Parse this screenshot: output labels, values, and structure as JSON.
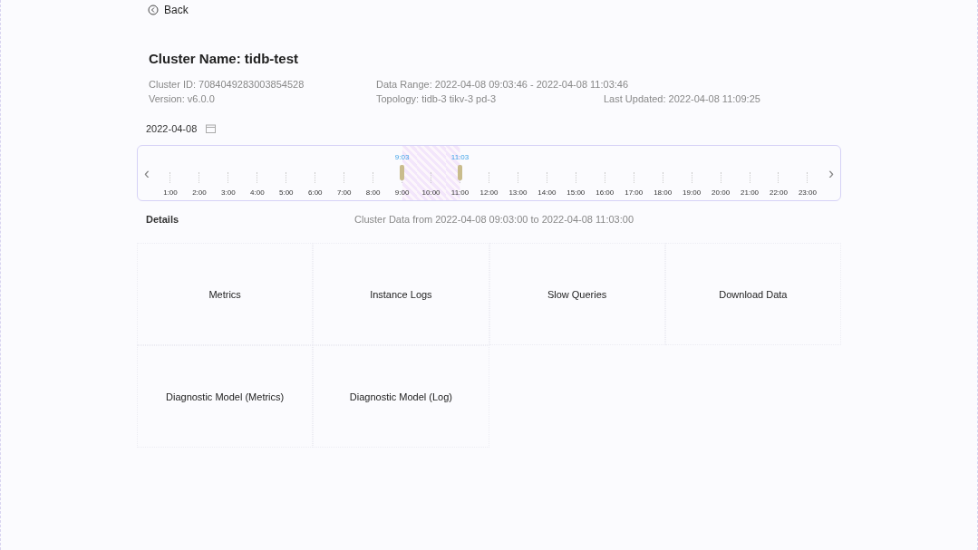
{
  "back": {
    "label": "Back"
  },
  "title": "Cluster Name: tidb-test",
  "info": [
    [
      "Cluster ID: 7084049283003854528",
      "Data Range: 2022-04-08 09:03:46 - 2022-04-08 11:03:46"
    ],
    [
      "Version: v6.0.0",
      "Topology: tidb-3 tikv-3 pd-3",
      "Last Updated: 2022-04-08 11:09:25"
    ]
  ],
  "date": "2022-04-08",
  "timeline": {
    "prev": "‹",
    "next": "›",
    "start_label": "9:03",
    "end_label": "11:03",
    "hours": [
      {
        "label": "1:00",
        "in_range": false
      },
      {
        "label": "2:00",
        "in_range": false
      },
      {
        "label": "3:00",
        "in_range": false
      },
      {
        "label": "4:00",
        "in_range": false
      },
      {
        "label": "5:00",
        "in_range": false
      },
      {
        "label": "6:00",
        "in_range": false
      },
      {
        "label": "7:00",
        "in_range": false
      },
      {
        "label": "8:00",
        "in_range": false
      },
      {
        "label": "9:00",
        "in_range": true
      },
      {
        "label": "10:00",
        "in_range": true
      },
      {
        "label": "11:00",
        "in_range": true
      },
      {
        "label": "12:00",
        "in_range": false
      },
      {
        "label": "13:00",
        "in_range": false
      },
      {
        "label": "14:00",
        "in_range": false
      },
      {
        "label": "15:00",
        "in_range": false
      },
      {
        "label": "16:00",
        "in_range": false
      },
      {
        "label": "17:00",
        "in_range": false
      },
      {
        "label": "18:00",
        "in_range": false
      },
      {
        "label": "19:00",
        "in_range": false
      },
      {
        "label": "20:00",
        "in_range": false
      },
      {
        "label": "21:00",
        "in_range": false
      },
      {
        "label": "22:00",
        "in_range": false
      },
      {
        "label": "23:00",
        "in_range": false
      }
    ]
  },
  "details": {
    "label": "Details",
    "summary": "Cluster Data from 2022-04-08 09:03:00 to 2022-04-08 11:03:00"
  },
  "cards": [
    {
      "label": "Metrics"
    },
    {
      "label": "Instance Logs"
    },
    {
      "label": "Slow Queries"
    },
    {
      "label": "Download Data"
    },
    {
      "label": "Diagnostic Model (Metrics)"
    },
    {
      "label": "Diagnostic Model (Log)"
    }
  ]
}
